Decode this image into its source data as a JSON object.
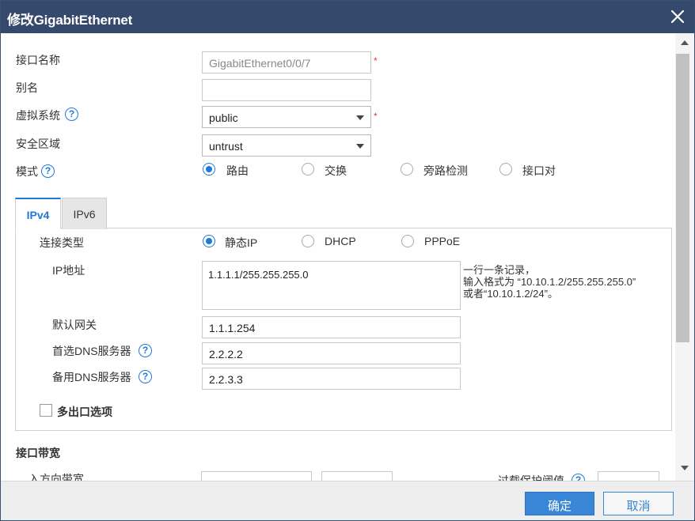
{
  "dialog": {
    "title": "修改GigabitEthernet"
  },
  "form": {
    "interface_name": {
      "label": "接口名称",
      "value": "GigabitEthernet0/0/7"
    },
    "alias": {
      "label": "别名",
      "value": ""
    },
    "virtual_system": {
      "label": "虚拟系统",
      "value": "public"
    },
    "security_zone": {
      "label": "安全区域",
      "value": "untrust"
    },
    "mode": {
      "label": "模式",
      "options": [
        "路由",
        "交换",
        "旁路检测",
        "接口对"
      ],
      "selected": "路由"
    },
    "required_mark": "*",
    "help_glyph": "?"
  },
  "tabs": [
    {
      "label": "IPv4",
      "active": true
    },
    {
      "label": "IPv6",
      "active": false
    }
  ],
  "ipv4": {
    "connection_type": {
      "label": "连接类型",
      "options": [
        "静态IP",
        "DHCP",
        "PPPoE"
      ],
      "selected": "静态IP"
    },
    "ip_address": {
      "label": "IP地址",
      "value": "1.1.1.1/255.255.255.0",
      "hint_lines": [
        "一行一条记录，",
        "输入格式为 “10.10.1.2/255.255.255.0”",
        "或者“10.10.1.2/24”。"
      ]
    },
    "default_gateway": {
      "label": "默认网关",
      "value": "1.1.1.254"
    },
    "primary_dns": {
      "label": "首选DNS服务器",
      "value": "2.2.2.2"
    },
    "secondary_dns": {
      "label": "备用DNS服务器",
      "value": "2.2.3.3"
    },
    "multi_egress": {
      "label": "多出口选项",
      "checked": false
    }
  },
  "bandwidth": {
    "section_label": "接口带宽",
    "inbound_label": "入方向带宽",
    "overload_label": "过载保护阈值"
  },
  "footer": {
    "ok_label": "确定",
    "cancel_label": "取消"
  },
  "colors": {
    "titlebar": "#34496b",
    "accent": "#1f7ad6",
    "primary_button": "#3a86d6",
    "required": "#e53935"
  }
}
